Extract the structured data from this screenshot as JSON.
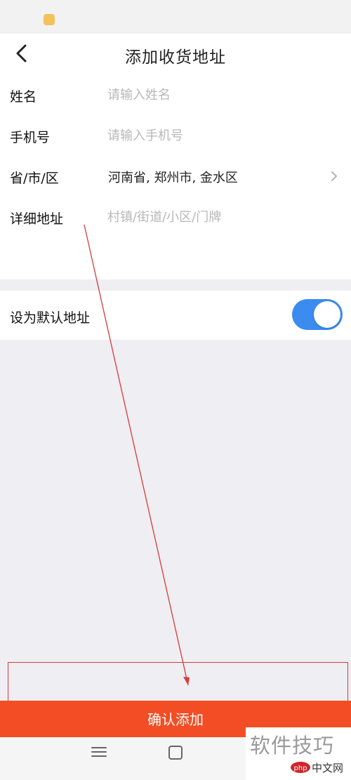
{
  "app": {
    "title": "添加收货地址"
  },
  "form": {
    "rows": [
      {
        "label": "姓名",
        "placeholder": "请输入姓名",
        "value": ""
      },
      {
        "label": "手机号",
        "placeholder": "请输入手机号",
        "value": ""
      },
      {
        "label": "省/市/区",
        "value": "河南省, 郑州市, 金水区"
      },
      {
        "label": "详细地址",
        "placeholder": "村镇/街道/小区/门牌",
        "value": ""
      }
    ]
  },
  "default_address": {
    "label": "设为默认地址",
    "enabled": true
  },
  "confirm": {
    "label": "确认添加"
  },
  "watermark": {
    "top_text": "软件技巧",
    "logo_text": "php中文网"
  },
  "icons": {
    "back": "chevron-left-icon",
    "region_arrow": "chevron-right-icon",
    "nav_menu": "menu-icon",
    "nav_home": "home-icon"
  },
  "colors": {
    "primary": "#f24d24",
    "toggle_on": "#3c8cf0",
    "annotation": "#d83a3a",
    "page_bg": "#efeef2"
  }
}
